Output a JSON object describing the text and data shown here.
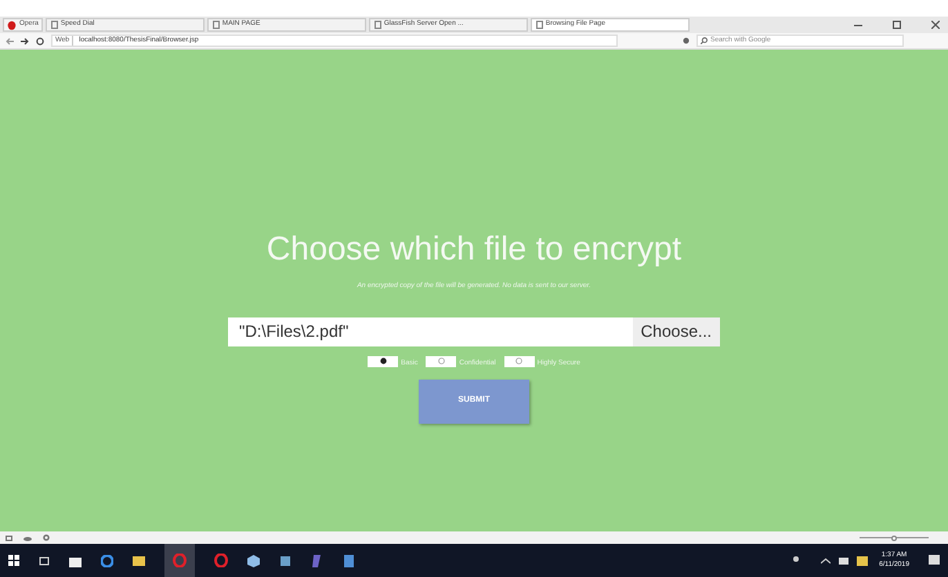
{
  "browser": {
    "menu_label": "Opera",
    "tabs": [
      {
        "label": "Speed Dial",
        "selected": false
      },
      {
        "label": "MAIN PAGE",
        "selected": false
      },
      {
        "label": "GlassFish Server Open ...",
        "selected": false
      },
      {
        "label": "Browsing File Page",
        "selected": true
      }
    ],
    "address": {
      "badge": "Web",
      "url": "localhost:8080/ThesisFinal/Browser.jsp"
    },
    "search": {
      "placeholder": "Search with Google"
    }
  },
  "page": {
    "title": "Choose which file to encrypt",
    "subtitle": "An encrypted copy of the file will be generated. No data is sent to our server.",
    "file": {
      "value": "\"D:\\Files\\2.pdf\"",
      "button": "Choose..."
    },
    "options": [
      {
        "label": "Basic",
        "selected": true
      },
      {
        "label": "Confidential",
        "selected": false
      },
      {
        "label": "Highly Secure",
        "selected": false
      }
    ],
    "submit": "SUBMIT"
  },
  "status_bar": {
    "zoom": {
      "level": 0.5
    }
  },
  "taskbar": {
    "time": "1:37 AM",
    "date": "6/11/2019"
  }
}
